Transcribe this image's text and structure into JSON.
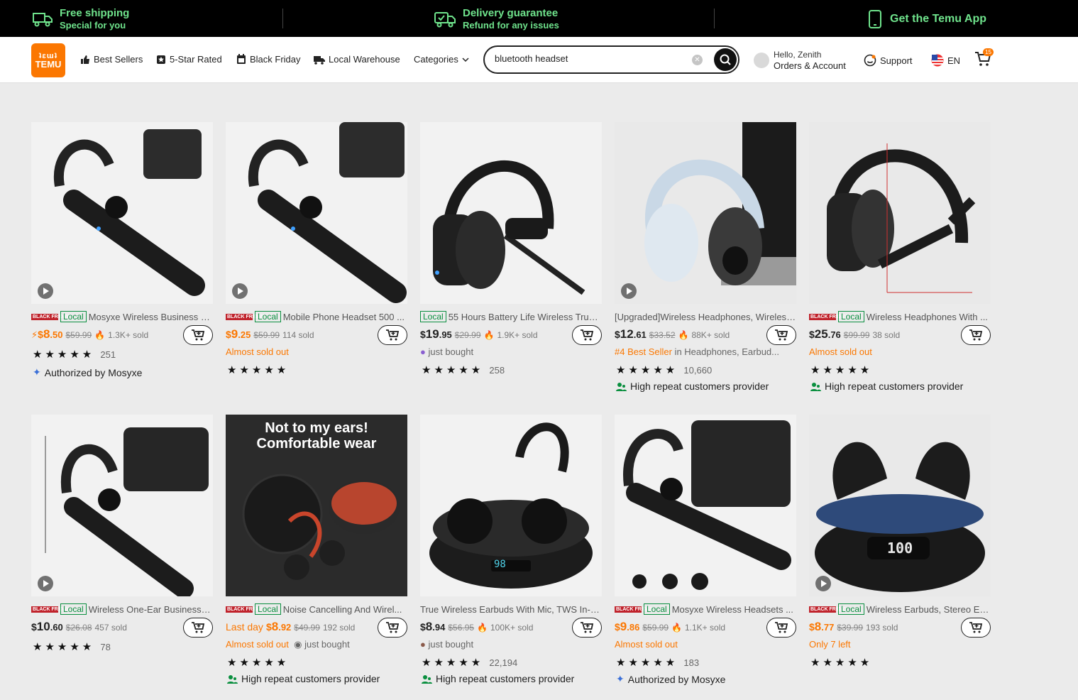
{
  "promo": {
    "free_shipping_title": "Free shipping",
    "free_shipping_sub": "Special for you",
    "delivery_title": "Delivery guarantee",
    "delivery_sub": "Refund for any issues",
    "app_label": "Get the Temu App"
  },
  "header": {
    "logo_top": "ʇɛɯʇ",
    "logo_bottom": "TEMU",
    "nav": {
      "best_sellers": "Best Sellers",
      "five_star": "5-Star Rated",
      "black_friday": "Black Friday",
      "local_warehouse": "Local Warehouse",
      "categories": "Categories"
    },
    "search_value": "bluetooth headset",
    "account_hello": "Hello, Zenith",
    "account_orders": "Orders & Account",
    "support": "Support",
    "language": "EN",
    "cart_count": "15"
  },
  "colors": {
    "brand": "#fb7701",
    "local_green": "#0a8f3f",
    "black_friday_red": "#c0232c"
  },
  "products": [
    {
      "title": "Mosyxe Wireless Business H...",
      "bf": "BLACK FRIDAY",
      "local": "Local",
      "price_cur": "$",
      "price_int": "8",
      "price_dec": ".50",
      "price_prefix": "⚡",
      "old": "$59.99",
      "sold": "1.3K+ sold",
      "stars": "★★★★★",
      "reviews": "251",
      "badge": "Authorized by Mosyxe"
    },
    {
      "title": "Mobile Phone Headset 500 ...",
      "bf": "BLACK FRIDAY",
      "local": "Local",
      "price_cur": "$",
      "price_int": "9",
      "price_dec": ".25",
      "old": "$59.99",
      "sold": "114 sold",
      "status": "Almost sold out",
      "stars": "★★★★★"
    },
    {
      "title": "55 Hours Battery Life Wireless Truck...",
      "local": "Local",
      "price_cur": "$",
      "price_int": "19",
      "price_dec": ".95",
      "old": "$29.99",
      "sold": "1.9K+ sold",
      "status": "just bought",
      "stars": "★★★★★",
      "reviews": "258"
    },
    {
      "title": "[Upgraded]Wireless Headphones, Wireless...",
      "price_cur": "$",
      "price_int": "12",
      "price_dec": ".61",
      "old": "$33.52",
      "sold": "88K+ sold",
      "status": "#4 Best Seller",
      "status_sub": " in Headphones, Earbud...",
      "stars": "★★★★★",
      "reviews": "10,660",
      "badge": "High repeat customers provider"
    },
    {
      "title": "Wireless Headphones With ...",
      "bf": "BLACK FRIDAY",
      "local": "Local",
      "price_cur": "$",
      "price_int": "25",
      "price_dec": ".76",
      "old": "$99.99",
      "sold": "38 sold",
      "status": "Almost sold out",
      "stars": "★★★★★",
      "badge": "High repeat customers provider"
    },
    {
      "title": "Wireless One-Ear Business E...",
      "bf": "BLACK FRIDAY",
      "local": "Local",
      "price_cur": "$",
      "price_int": "10",
      "price_dec": ".60",
      "old": "$26.08",
      "sold": "457 sold",
      "stars": "★★★★★",
      "reviews": "78"
    },
    {
      "title": "Noise Cancelling And Wirel...",
      "bf": "BLACK FRIDAY",
      "local": "Local",
      "price_prefix_text": "Last day",
      "price_cur": "$",
      "price_int": "8",
      "price_dec": ".92",
      "old": "$49.99",
      "sold": "192 sold",
      "status": "Almost sold out",
      "status_sub": "just bought",
      "stars": "★★★★★",
      "badge": "High repeat customers provider",
      "image_heading": "Not to my ears!",
      "image_heading2": "Comfortable wear"
    },
    {
      "title": "True Wireless Earbuds With Mic, TWS In-Ea...",
      "price_cur": "$",
      "price_int": "8",
      "price_dec": ".94",
      "old": "$56.95",
      "sold": "100K+ sold",
      "status": "just bought",
      "stars": "★★★★★",
      "reviews": "22,194",
      "badge": "High repeat customers provider",
      "image_display": "98"
    },
    {
      "title": "Mosyxe Wireless Headsets ...",
      "bf": "BLACK FRIDAY",
      "local": "Local",
      "price_cur": "$",
      "price_int": "9",
      "price_dec": ".86",
      "old": "$59.99",
      "sold": "1.1K+ sold",
      "status": "Almost sold out",
      "stars": "★★★★★",
      "reviews": "183",
      "badge": "Authorized by Mosyxe"
    },
    {
      "title": "Wireless Earbuds, Stereo Ear...",
      "bf": "BLACK FRIDAY",
      "local": "Local",
      "price_cur": "$",
      "price_int": "8",
      "price_dec": ".77",
      "old": "$39.99",
      "sold": "193 sold",
      "status": "Only 7 left",
      "stars": "★★★★★",
      "image_display": "100"
    }
  ]
}
